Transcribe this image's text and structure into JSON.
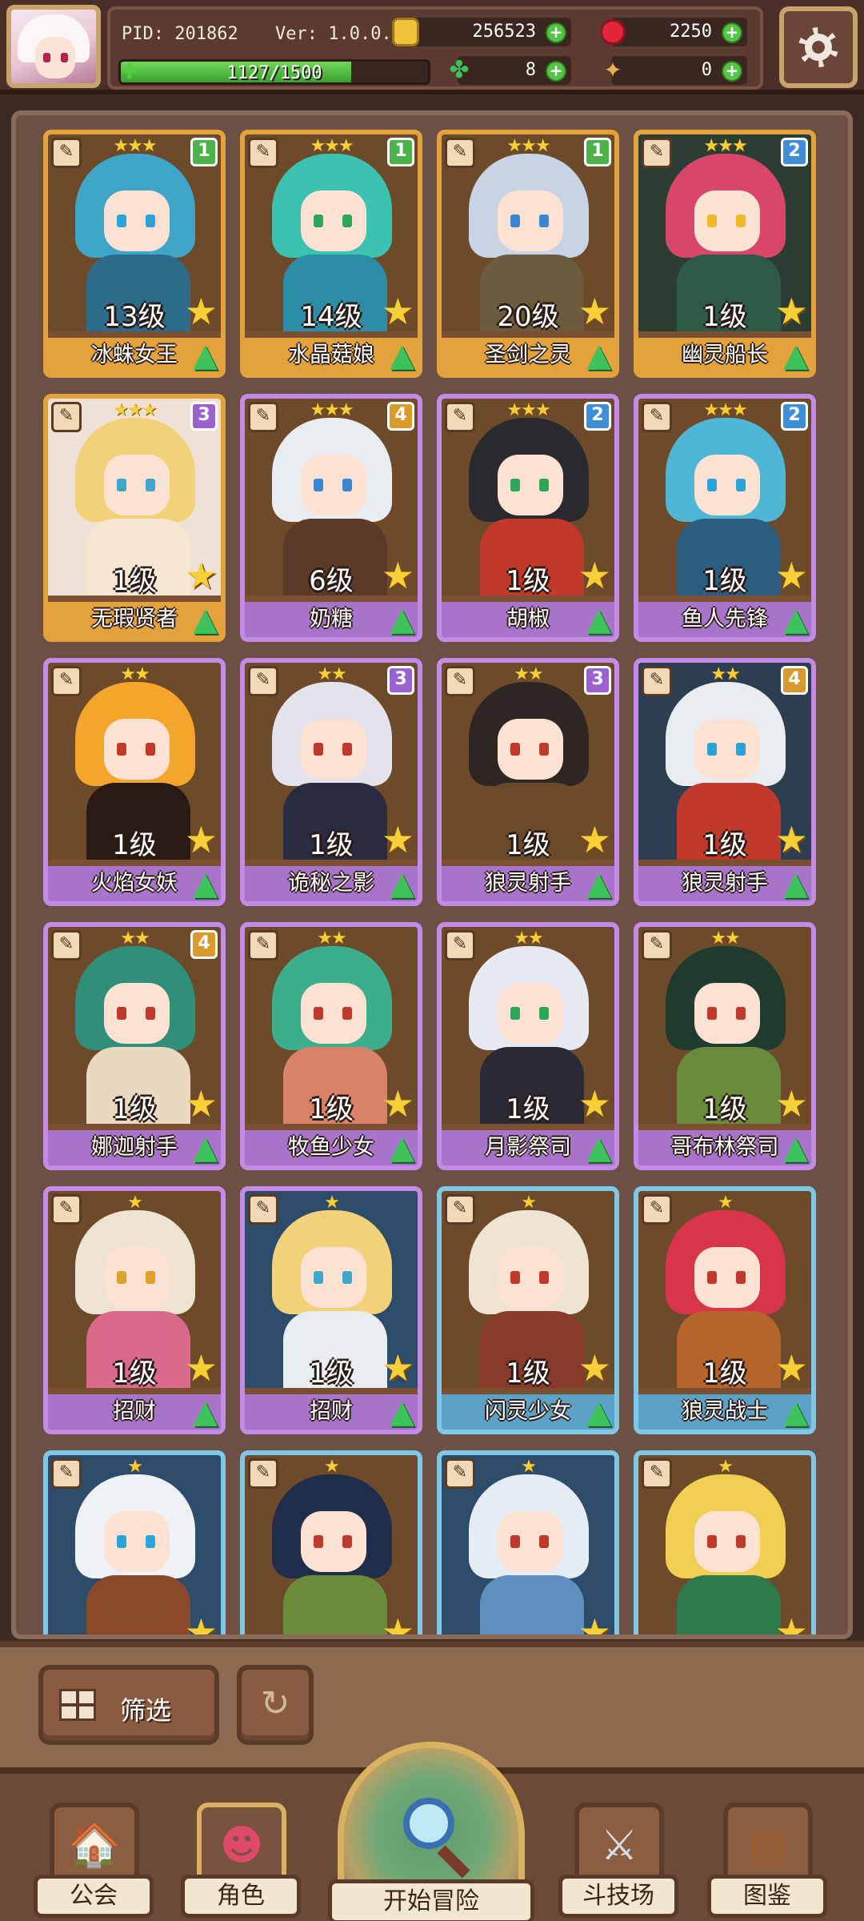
{
  "header": {
    "pid": "PID: 201862",
    "version": "Ver: 1.0.0.0",
    "gold": "256523",
    "gems": "2250",
    "exp_text": "1127/1500",
    "exp_progress": 0.7513,
    "clover": "8",
    "bone": "0"
  },
  "cards": [
    {
      "name": "冰蛛女王",
      "level": "13级",
      "stars": "★★★",
      "tier": "1",
      "frame": "orange",
      "hair": "#3fa6c9",
      "body": "#2c6b8a",
      "eye": "#2aa4d8",
      "bg": "#6d4a2a"
    },
    {
      "name": "水晶菇娘",
      "level": "14级",
      "stars": "★★★",
      "tier": "1",
      "frame": "orange",
      "hair": "#3cc2b0",
      "body": "#2c8ea6",
      "eye": "#2fa65a",
      "bg": "#6d4a2a"
    },
    {
      "name": "圣剑之灵",
      "level": "20级",
      "stars": "★★★",
      "tier": "1",
      "frame": "orange",
      "hair": "#c9d3e6",
      "body": "#6c5b3c",
      "eye": "#3a86d0",
      "bg": "#6d4a2a"
    },
    {
      "name": "幽灵船长",
      "level": "1级",
      "stars": "★★★",
      "tier": "2",
      "frame": "orange",
      "hair": "#d8476a",
      "body": "#2e5b48",
      "eye": "#f0b92a",
      "bg": "#2c3e34"
    },
    {
      "name": "无瑕贤者",
      "level": "1级",
      "stars": "★★★",
      "tier": "3",
      "frame": "orange",
      "hair": "#f2d278",
      "body": "#f6e7d2",
      "eye": "#3fa6c9",
      "bg": "#efe1d6"
    },
    {
      "name": "奶糖",
      "level": "6级",
      "stars": "★★★",
      "tier": "4",
      "frame": "purple",
      "hair": "#e9edf2",
      "body": "#5b3a2a",
      "eye": "#3a86d0",
      "bg": "#6d4a2a"
    },
    {
      "name": "胡椒",
      "level": "1级",
      "stars": "★★★",
      "tier": "2",
      "frame": "purple",
      "hair": "#2a2a2e",
      "body": "#c0392b",
      "eye": "#2fa65a",
      "bg": "#6d4a2a"
    },
    {
      "name": "鱼人先锋",
      "level": "1级",
      "stars": "★★★",
      "tier": "2",
      "frame": "purple",
      "hair": "#4fb6d6",
      "body": "#2b5d80",
      "eye": "#2aa4d8",
      "bg": "#6d4a2a"
    },
    {
      "name": "火焰女妖",
      "level": "1级",
      "stars": "★★",
      "tier": "",
      "frame": "purple",
      "hair": "#f3a52c",
      "body": "#2a1a14",
      "eye": "#c0392b",
      "bg": "#6d4a2a"
    },
    {
      "name": "诡秘之影",
      "level": "1级",
      "stars": "★★",
      "tier": "3",
      "frame": "purple",
      "hair": "#e4e2ea",
      "body": "#2a2a40",
      "eye": "#c0392b",
      "bg": "#6d4a2a"
    },
    {
      "name": "狼灵射手",
      "level": "1级",
      "stars": "★★",
      "tier": "3",
      "frame": "purple",
      "hair": "#2e2622",
      "body": "#6b4a2a",
      "eye": "#c0392b",
      "bg": "#6d4a2a"
    },
    {
      "name": "狼灵射手",
      "level": "1级",
      "stars": "★★",
      "tier": "4",
      "frame": "purple",
      "hair": "#e9edf2",
      "body": "#c0392b",
      "eye": "#2aa4d8",
      "bg": "#2c3e50"
    },
    {
      "name": "娜迦射手",
      "level": "1级",
      "stars": "★★",
      "tier": "4",
      "frame": "purple",
      "hair": "#2f8f78",
      "body": "#e9d9c0",
      "eye": "#c0392b",
      "bg": "#6d4a2a"
    },
    {
      "name": "牧鱼少女",
      "level": "1级",
      "stars": "★★",
      "tier": "",
      "frame": "purple",
      "hair": "#3cae8c",
      "body": "#d9826a",
      "eye": "#c0392b",
      "bg": "#6d4a2a"
    },
    {
      "name": "月影祭司",
      "level": "1级",
      "stars": "★★",
      "tier": "",
      "frame": "purple",
      "hair": "#e7e9f2",
      "body": "#2a2a36",
      "eye": "#2fa65a",
      "bg": "#6d4a2a"
    },
    {
      "name": "哥布林祭司",
      "level": "1级",
      "stars": "★★",
      "tier": "",
      "frame": "purple",
      "hair": "#1f3b2e",
      "body": "#6a8c3a",
      "eye": "#c0392b",
      "bg": "#6d4a2a"
    },
    {
      "name": "招财",
      "level": "1级",
      "stars": "★",
      "tier": "",
      "frame": "purple",
      "hair": "#efe3d2",
      "body": "#d96a8a",
      "eye": "#e0a32a",
      "bg": "#6d4a2a"
    },
    {
      "name": "招财",
      "level": "1级",
      "stars": "★",
      "tier": "",
      "frame": "purple",
      "hair": "#f2d278",
      "body": "#e9edf2",
      "eye": "#3fa6c9",
      "bg": "#2d4c6a"
    },
    {
      "name": "闪灵少女",
      "level": "1级",
      "stars": "★",
      "tier": "",
      "frame": "blue",
      "hair": "#efe3d2",
      "body": "#8a3a2a",
      "eye": "#c0392b",
      "bg": "#6d4a2a"
    },
    {
      "name": "狼灵战士",
      "level": "1级",
      "stars": "★",
      "tier": "",
      "frame": "blue",
      "hair": "#d8344a",
      "body": "#b5652a",
      "eye": "#c0392b",
      "bg": "#6d4a2a"
    },
    {
      "name": "",
      "level": "",
      "stars": "★",
      "tier": "",
      "frame": "blue",
      "hair": "#eef1f6",
      "body": "#8a4a2a",
      "eye": "#2aa4d8",
      "bg": "#2d4c6a"
    },
    {
      "name": "",
      "level": "",
      "stars": "★",
      "tier": "",
      "frame": "blue",
      "hair": "#1f2c4a",
      "body": "#6a8c3a",
      "eye": "#c0392b",
      "bg": "#6d4a2a"
    },
    {
      "name": "",
      "level": "",
      "stars": "★",
      "tier": "",
      "frame": "blue",
      "hair": "#e6ecf3",
      "body": "#5f8fbf",
      "eye": "#c0392b",
      "bg": "#2d4c6a"
    },
    {
      "name": "",
      "level": "",
      "stars": "★",
      "tier": "",
      "frame": "blue",
      "hair": "#f0cf52",
      "body": "#2f7a4a",
      "eye": "#c0392b",
      "bg": "#6d4a2a"
    }
  ],
  "filter": {
    "label": "筛选"
  },
  "nav": {
    "guild": "公会",
    "role": "角色",
    "start": "开始冒险",
    "arena": "斗技场",
    "codex": "图鉴"
  },
  "colors": {
    "gold": "#f0c23c",
    "gem": "#e2253a",
    "exp": "#4fcf3f",
    "frame_orange": "#e3a23b",
    "frame_purple": "#c38ae6",
    "frame_blue": "#7fc7e6"
  }
}
